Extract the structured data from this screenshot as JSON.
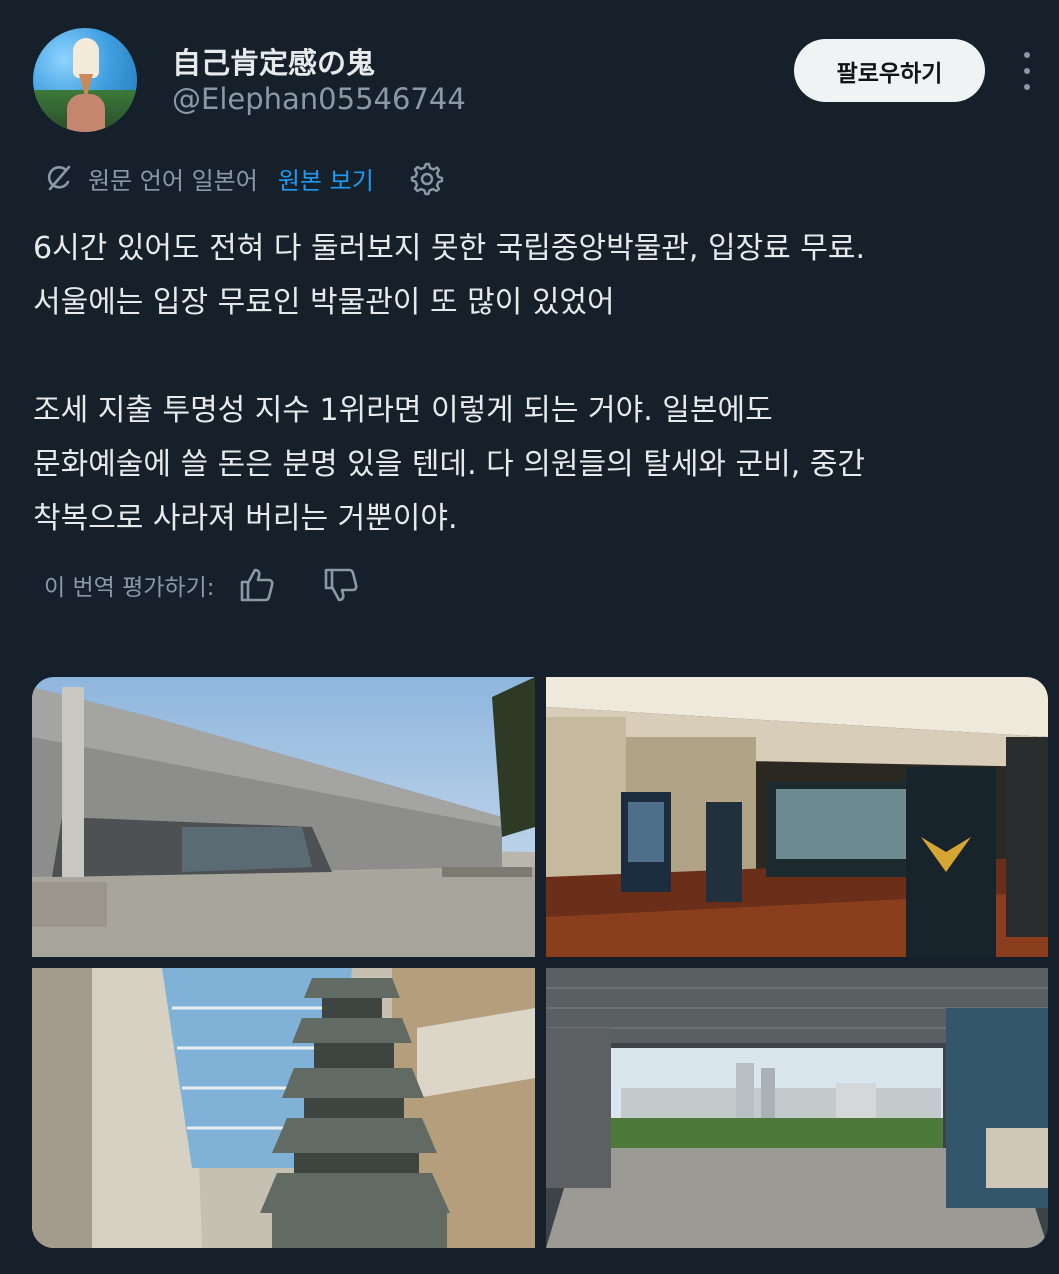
{
  "user": {
    "display_name": "自己肯定感の鬼",
    "handle": "@Elephan05546744"
  },
  "actions": {
    "follow_label": "팔로우하기"
  },
  "translation": {
    "source_label": "원문 언어 일본어",
    "view_original": "원본 보기"
  },
  "tweet": {
    "lines": [
      "6시간 있어도 전혀 다 둘러보지 못한 국립중앙박물관, 입장료 무료.",
      "서울에는 입장 무료인 박물관이 또 많이 있었어",
      "",
      "조세 지출 투명성 지수 1위라면 이렇게 되는 거야. 일본에도",
      "문화예술에 쓸 돈은 분명 있을 텐데. 다 의원들의 탈세와 군비, 중간",
      "착복으로 사라져 버리는 거뿐이야."
    ]
  },
  "rating": {
    "label": "이 번역 평가하기:"
  },
  "colors": {
    "background": "#15202b",
    "text": "#e7e9ea",
    "muted": "#8b98a5",
    "link": "#1d9bf0",
    "button_bg": "#eff3f4"
  },
  "icons": [
    "translate-icon",
    "settings-gear-icon",
    "thumbs-up-icon",
    "thumbs-down-icon",
    "more-options-icon"
  ]
}
